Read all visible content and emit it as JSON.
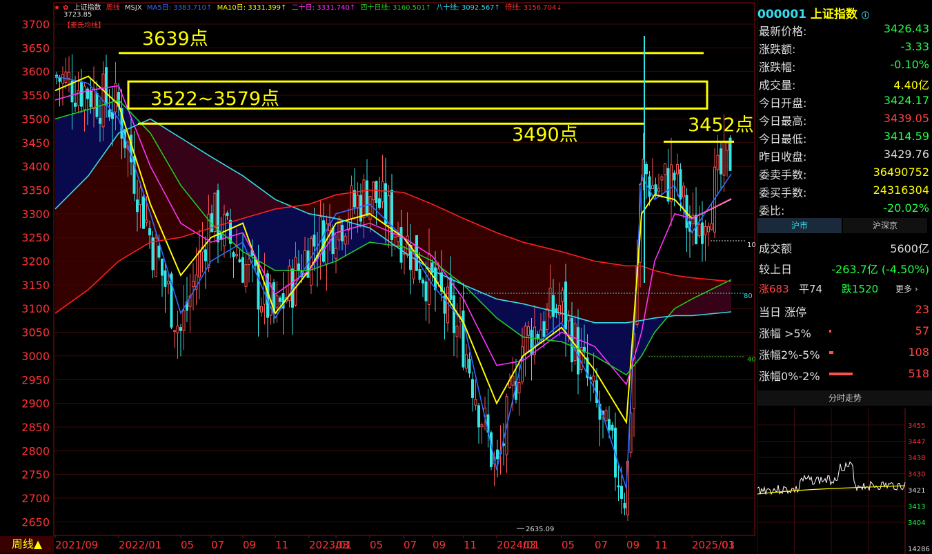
{
  "header": {
    "title": "上证指数",
    "period": "周线",
    "indicator": "MSJX",
    "ma5": "MA5日: 3383.710↑",
    "ma10": "MA10日: 3331.399↑",
    "ma20": "二十日: 3331.740↑",
    "ma40": "四十日线: 3160.501↑",
    "ma80": "八十线: 3092.567↑",
    "bei": "倍线: 3156.704↓",
    "max_label": "3723.85",
    "min_label": "2635.09",
    "legend_tag": "【麦氏均线】"
  },
  "colors": {
    "ma5": "#2f6bff",
    "ma10": "#ffff00",
    "ma20": "#ff33ff",
    "ma40": "#22cc22",
    "ma80": "#33ddee",
    "bei": "#ff2020",
    "up": "#ff5555",
    "down": "#33e6e6",
    "annot": "#ffff00",
    "grid": "#3a0a0a"
  },
  "annotations": [
    {
      "text": "3639点",
      "price": 3639
    },
    {
      "text": "3522~3579点",
      "price_low": 3522,
      "price_high": 3579
    },
    {
      "text": "3490点",
      "price": 3490
    },
    {
      "text": "3452点",
      "price": 3452
    }
  ],
  "right_markers": {
    "m10": "10",
    "m80": "80",
    "m40": "40"
  },
  "period_button": "周线▲",
  "chart_data": {
    "type": "candlestick",
    "title": "上证指数 周线",
    "ylim": [
      2600,
      3740
    ],
    "y_ticks": [
      2650,
      2700,
      2750,
      2800,
      2850,
      2900,
      2950,
      3000,
      3050,
      3100,
      3150,
      3200,
      3250,
      3300,
      3350,
      3400,
      3450,
      3500,
      3550,
      3600,
      3650,
      3700
    ],
    "x_ticks": [
      "2021/09",
      "2022/01",
      "05",
      "07",
      "09",
      "11",
      "2023/01",
      "03",
      "05",
      "07",
      "09",
      "11",
      "2024/01",
      "03",
      "05",
      "07",
      "09",
      "11",
      "2025/01",
      "03"
    ],
    "close_path": [
      [
        "2021/09",
        3590
      ],
      [
        "2021/11",
        3560
      ],
      [
        "2022/01",
        3520
      ],
      [
        "2022/03",
        3250
      ],
      [
        "2022/05",
        3050
      ],
      [
        "2022/07",
        3300
      ],
      [
        "2022/09",
        3200
      ],
      [
        "2022/11",
        3080
      ],
      [
        "2023/01",
        3230
      ],
      [
        "2023/03",
        3280
      ],
      [
        "2023/05",
        3350
      ],
      [
        "2023/07",
        3250
      ],
      [
        "2023/09",
        3150
      ],
      [
        "2023/11",
        3030
      ],
      [
        "2024/01",
        2750
      ],
      [
        "2024/03",
        3030
      ],
      [
        "2024/05",
        3110
      ],
      [
        "2024/07",
        2900
      ],
      [
        "2024/09",
        2700
      ],
      [
        "2024/10",
        3400
      ],
      [
        "2024/11",
        3350
      ],
      [
        "2024/12",
        3380
      ],
      [
        "2025/01",
        3250
      ],
      [
        "2025/03",
        3426
      ]
    ],
    "series": [
      {
        "name": "MA5日",
        "values": [
          3590,
          3575,
          3500,
          3300,
          3090,
          3200,
          3240,
          3080,
          3200,
          3300,
          3320,
          3250,
          3150,
          3070,
          2760,
          3000,
          3070,
          2930,
          2720,
          3380,
          3330,
          3360,
          3260,
          3384
        ]
      },
      {
        "name": "MA10日",
        "values": [
          3560,
          3590,
          3530,
          3320,
          3170,
          3250,
          3280,
          3090,
          3180,
          3280,
          3300,
          3250,
          3170,
          3070,
          2900,
          3000,
          3060,
          2970,
          2860,
          3300,
          3340,
          3330,
          3290,
          3331
        ]
      },
      {
        "name": "二十日",
        "values": [
          3540,
          3560,
          3570,
          3400,
          3280,
          3240,
          3260,
          3130,
          3180,
          3260,
          3280,
          3250,
          3210,
          3120,
          2980,
          2990,
          3050,
          3020,
          2940,
          3050,
          3200,
          3300,
          3290,
          3332
        ]
      },
      {
        "name": "四十日线",
        "values": [
          3500,
          3520,
          3540,
          3470,
          3360,
          3280,
          3220,
          3180,
          3180,
          3200,
          3240,
          3230,
          3200,
          3150,
          3080,
          3040,
          3030,
          3000,
          2960,
          3000,
          3050,
          3100,
          3120,
          3161
        ]
      },
      {
        "name": "八十线",
        "values": [
          3310,
          3380,
          3470,
          3500,
          3460,
          3420,
          3380,
          3330,
          3300,
          3290,
          3270,
          3220,
          3180,
          3150,
          3120,
          3110,
          3090,
          3070,
          3070,
          3075,
          3080,
          3085,
          3085,
          3093
        ]
      },
      {
        "name": "倍线",
        "values": [
          3090,
          3140,
          3200,
          3240,
          3250,
          3270,
          3290,
          3310,
          3320,
          3340,
          3350,
          3345,
          3320,
          3290,
          3260,
          3240,
          3220,
          3200,
          3190,
          3190,
          3180,
          3170,
          3165,
          3157
        ]
      }
    ]
  },
  "quote": {
    "code": "000001",
    "name": "上证指数",
    "rows": [
      {
        "label": "最新价格:",
        "value": "3426.43",
        "color": "#22ff44"
      },
      {
        "label": "涨跌额:",
        "value": "-3.33",
        "color": "#22ff44"
      },
      {
        "label": "涨跌幅:",
        "value": "-0.10%",
        "color": "#22ff44"
      },
      {
        "label": "成交量:",
        "value": "4.40亿",
        "color": "#ffff00"
      },
      {
        "label": "今日开盘:",
        "value": "3424.17",
        "color": "#22ff44"
      },
      {
        "label": "今日最高:",
        "value": "3439.05",
        "color": "#ff4444"
      },
      {
        "label": "今日最低:",
        "value": "3414.59",
        "color": "#22ff44"
      },
      {
        "label": "昨日收盘:",
        "value": "3429.76",
        "color": "#dddddd"
      },
      {
        "label": "委卖手数:",
        "value": "36490752",
        "color": "#ffff00"
      },
      {
        "label": "委买手数:",
        "value": "24316304",
        "color": "#ffff00"
      },
      {
        "label": "委比:",
        "value": "-20.02%",
        "color": "#22ff44"
      }
    ]
  },
  "market": {
    "tabs": [
      "沪市",
      "沪深京"
    ],
    "turnover_label": "成交额",
    "turnover_value": "5600亿",
    "compare_label": "较上日",
    "compare_value": "-263.7亿 (-4.50%)",
    "up_label": "涨683",
    "flat_label": "平74",
    "down_label": "跌1520",
    "more_label": "更多 ›",
    "limit_label": "当日 涨停",
    "limit_value": "23",
    "g5_label": "涨幅 >5%",
    "g5_value": "57",
    "g25_label": "涨幅2%-5%",
    "g25_value": "108",
    "g02_label": "涨幅0%-2%",
    "g02_value": "518"
  },
  "intraday": {
    "title": "分时走势",
    "price_ticks": [
      "3455",
      "3447",
      "3438",
      "3430",
      "3421",
      "3413",
      "3404"
    ],
    "volume_label": "14286"
  }
}
